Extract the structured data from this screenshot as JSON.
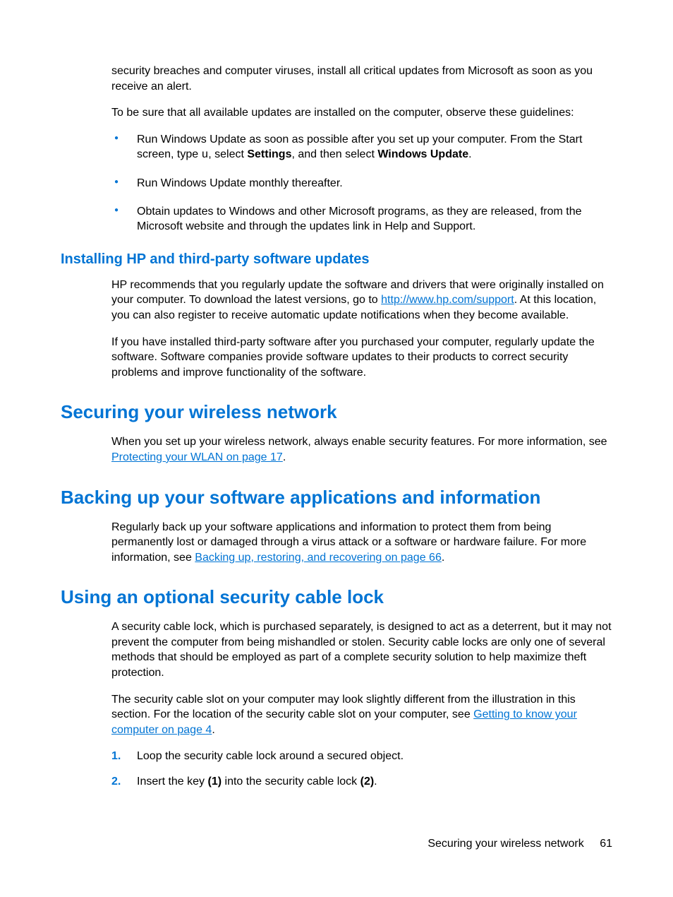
{
  "intro": {
    "p1": "security breaches and computer viruses, install all critical updates from Microsoft as soon as you receive an alert.",
    "p2": "To be sure that all available updates are installed on the computer, observe these guidelines:"
  },
  "bullets": {
    "b1_pre": "Run Windows Update as soon as possible after you set up your computer. From the Start screen, type ",
    "b1_u": "u",
    "b1_mid1": ", select ",
    "b1_bold1": "Settings",
    "b1_mid2": ", and then select ",
    "b1_bold2": "Windows Update",
    "b1_post": ".",
    "b2": "Run Windows Update monthly thereafter.",
    "b3": "Obtain updates to Windows and other Microsoft programs, as they are released, from the Microsoft website and through the updates link in Help and Support."
  },
  "sectionA": {
    "heading": "Installing HP and third-party software updates",
    "p1_pre": "HP recommends that you regularly update the software and drivers that were originally installed on your computer. To download the latest versions, go to ",
    "p1_link": "http://www.hp.com/support",
    "p1_post": ". At this location, you can also register to receive automatic update notifications when they become available.",
    "p2": "If you have installed third-party software after you purchased your computer, regularly update the software. Software companies provide software updates to their products to correct security problems and improve functionality of the software."
  },
  "sectionB": {
    "heading": "Securing your wireless network",
    "p1_pre": "When you set up your wireless network, always enable security features. For more information, see ",
    "p1_link": "Protecting your WLAN on page 17",
    "p1_post": "."
  },
  "sectionC": {
    "heading": "Backing up your software applications and information",
    "p1_pre": "Regularly back up your software applications and information to protect them from being permanently lost or damaged through a virus attack or a software or hardware failure. For more information, see ",
    "p1_link": "Backing up, restoring, and recovering on page 66",
    "p1_post": "."
  },
  "sectionD": {
    "heading": "Using an optional security cable lock",
    "p1": "A security cable lock, which is purchased separately, is designed to act as a deterrent, but it may not prevent the computer from being mishandled or stolen. Security cable locks are only one of several methods that should be employed as part of a complete security solution to help maximize theft protection.",
    "p2_pre": "The security cable slot on your computer may look slightly different from the illustration in this section. For the location of the security cable slot on your computer, see ",
    "p2_link": "Getting to know your computer on page 4",
    "p2_post": ".",
    "step1": "Loop the security cable lock around a secured object.",
    "step2_pre": "Insert the key ",
    "step2_b1": "(1)",
    "step2_mid": " into the security cable lock ",
    "step2_b2": "(2)",
    "step2_post": "."
  },
  "footer": {
    "label": "Securing your wireless network",
    "page": "61"
  }
}
